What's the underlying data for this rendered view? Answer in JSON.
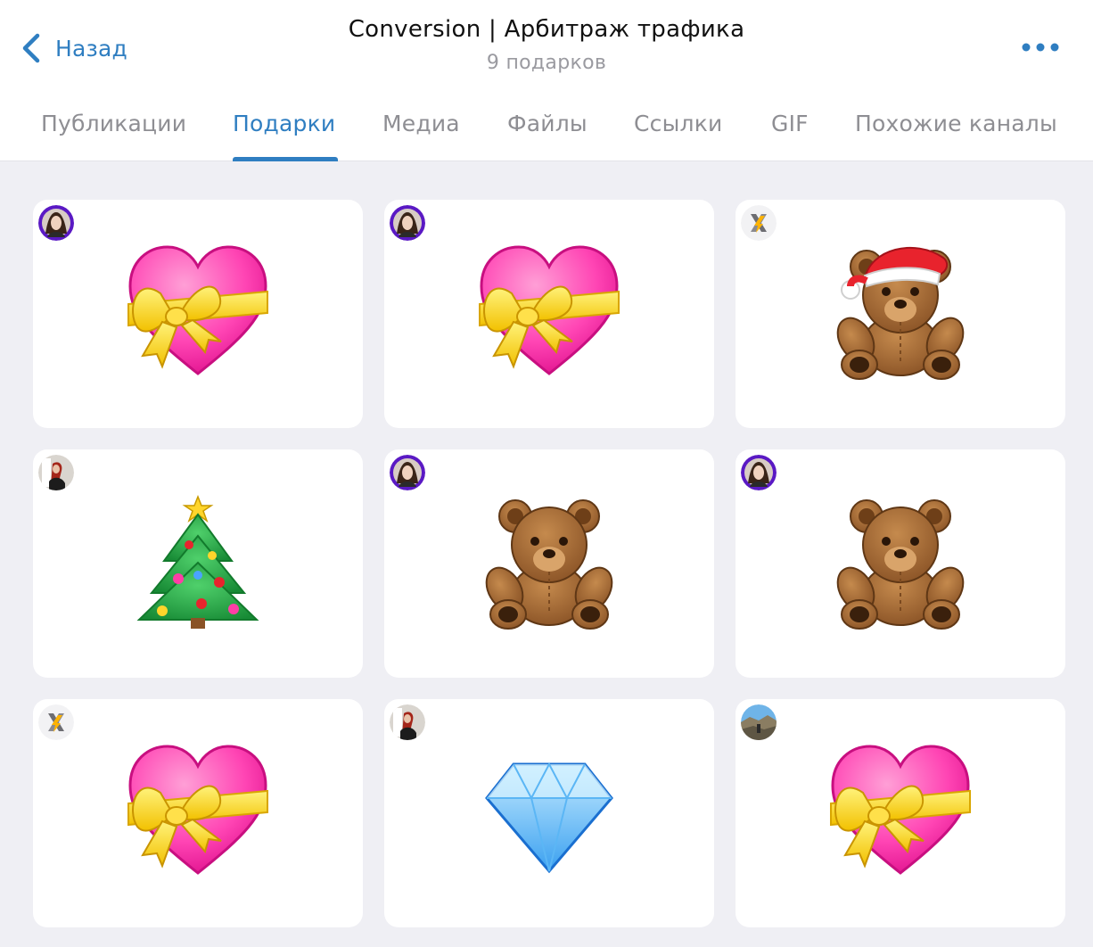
{
  "header": {
    "back_label": "Назад",
    "title": "Conversion | Арбитраж трафика",
    "subtitle": "9 подарков",
    "more_icon": "ellipsis-icon",
    "accent_color": "#2f7ec1"
  },
  "tabs": [
    {
      "label": "Публикации",
      "active": false
    },
    {
      "label": "Подарки",
      "active": true
    },
    {
      "label": "Медиа",
      "active": false
    },
    {
      "label": "Файлы",
      "active": false
    },
    {
      "label": "Ссылки",
      "active": false
    },
    {
      "label": "GIF",
      "active": false
    },
    {
      "label": "Похожие каналы",
      "active": false
    }
  ],
  "gifts": [
    {
      "gift": "heart-with-ribbon-icon",
      "sender_avatar": "purple-avatar"
    },
    {
      "gift": "heart-with-ribbon-icon",
      "sender_avatar": "purple-avatar"
    },
    {
      "gift": "santa-teddy-bear-icon",
      "sender_avatar": "x-logo-avatar"
    },
    {
      "gift": "christmas-tree-icon",
      "sender_avatar": "photo-avatar"
    },
    {
      "gift": "teddy-bear-icon",
      "sender_avatar": "purple-avatar"
    },
    {
      "gift": "teddy-bear-icon",
      "sender_avatar": "purple-avatar"
    },
    {
      "gift": "heart-with-ribbon-icon",
      "sender_avatar": "x-logo-avatar"
    },
    {
      "gift": "diamond-icon",
      "sender_avatar": "photo-avatar"
    },
    {
      "gift": "heart-with-ribbon-icon",
      "sender_avatar": "landscape-avatar"
    }
  ]
}
